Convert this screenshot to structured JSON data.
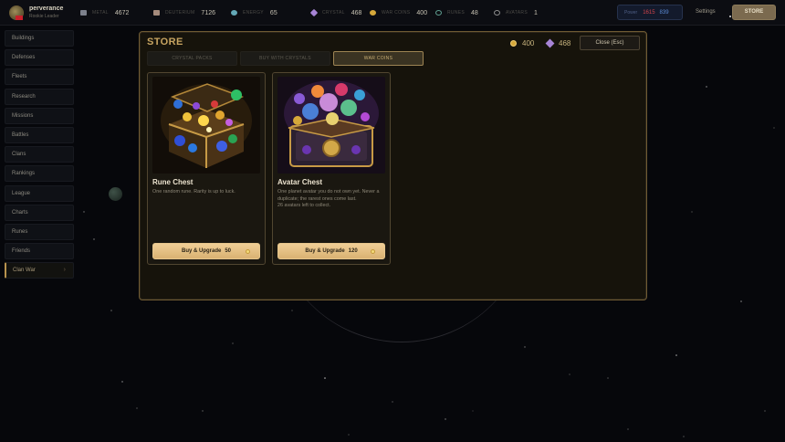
{
  "player": {
    "name": "perverance",
    "subtitle": "Rookie Leader"
  },
  "resources": [
    {
      "label": "Metal",
      "value": "4672",
      "color": "#7d818c"
    },
    {
      "label": "Deuterium",
      "value": "7126",
      "color": "#a58b7c"
    },
    {
      "label": "Energy",
      "value": "65",
      "color": "#64a9b7"
    },
    {
      "label": "Crystal",
      "value": "468",
      "color": "#a784d6"
    },
    {
      "label": "War Coins",
      "value": "400",
      "color": "#d6a83a"
    },
    {
      "label": "Runes",
      "value": "48",
      "color": "#5e9d8f"
    },
    {
      "label": "Avatars",
      "value": "1",
      "color": "#8d8d8d"
    }
  ],
  "power": {
    "label": "Power",
    "red": "1615",
    "blue": "839"
  },
  "topnav": {
    "settings": "Settings",
    "store": "STORE"
  },
  "sidebar": {
    "items": [
      {
        "label": "Buildings"
      },
      {
        "label": "Defenses"
      },
      {
        "label": "Fleets"
      },
      {
        "label": "Research"
      },
      {
        "label": "Missions"
      },
      {
        "label": "Battles"
      },
      {
        "label": "Clans"
      },
      {
        "label": "Rankings"
      },
      {
        "label": "League"
      },
      {
        "label": "Charts"
      },
      {
        "label": "Runes"
      },
      {
        "label": "Friends"
      },
      {
        "label": "Clan War"
      }
    ]
  },
  "store": {
    "title": "STORE",
    "coins": "400",
    "crystals": "468",
    "close_label": "Close (Esc)",
    "tabs": [
      {
        "label": "Crystal Packs"
      },
      {
        "label": "Buy with Crystals"
      },
      {
        "label": "War Coins"
      }
    ],
    "items": [
      {
        "name": "Rune Chest",
        "desc": "One random rune. Rarity is up to luck.",
        "button": "Buy & Upgrade",
        "price": "50"
      },
      {
        "name": "Avatar Chest",
        "desc": "One planet avatar you do not own yet. Never a duplicate; the rarest ones come last.",
        "desc2": "26 avatars left to collect.",
        "button": "Buy & Upgrade",
        "price": "120"
      }
    ]
  }
}
